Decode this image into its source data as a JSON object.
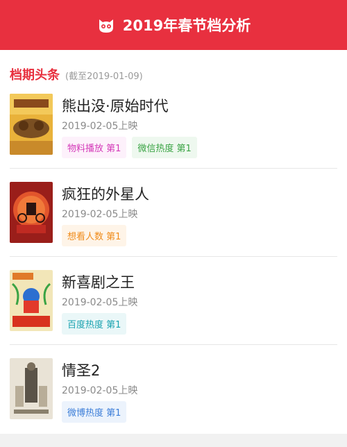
{
  "header": {
    "title": "2019年春节档分析"
  },
  "section": {
    "title": "档期头条",
    "subtitle": "(截至2019-01-09)"
  },
  "movies": [
    {
      "title": "熊出没·原始时代",
      "date": "2019-02-05上映",
      "tags": [
        {
          "label": "物料播放 第1",
          "color": "#d43bb9",
          "bg": "#fdf1fb"
        },
        {
          "label": "微信热度 第1",
          "color": "#3aa344",
          "bg": "#eef8ef"
        }
      ]
    },
    {
      "title": "疯狂的外星人",
      "date": "2019-02-05上映",
      "tags": [
        {
          "label": "想看人数 第1",
          "color": "#f08c1b",
          "bg": "#fef4e8"
        }
      ]
    },
    {
      "title": "新喜剧之王",
      "date": "2019-02-05上映",
      "tags": [
        {
          "label": "百度热度 第1",
          "color": "#1aa3b0",
          "bg": "#eaf7f8"
        }
      ]
    },
    {
      "title": "情圣2",
      "date": "2019-02-05上映",
      "tags": [
        {
          "label": "微博热度 第1",
          "color": "#3c7ed8",
          "bg": "#ecf3fc"
        }
      ]
    }
  ],
  "colors": {
    "brand": "#e8303f"
  }
}
